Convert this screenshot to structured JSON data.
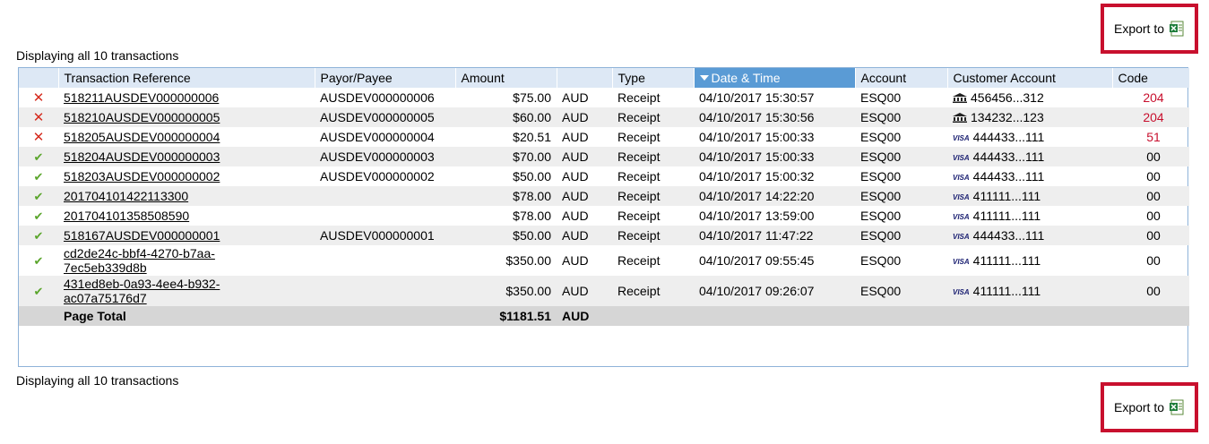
{
  "export": {
    "label": "Export to",
    "icon": "excel-icon"
  },
  "caption": {
    "top": "Displaying all 10 transactions",
    "bottom": "Displaying all 10 transactions"
  },
  "columns": {
    "ref": "Transaction Reference",
    "payor": "Payor/Payee",
    "amount": "Amount",
    "currency": "",
    "type": "Type",
    "datetime": "Date & Time",
    "account": "Account",
    "customer": "Customer Account",
    "code": "Code"
  },
  "sorted_column": "datetime",
  "rows": [
    {
      "status": "failed",
      "ref": "518211AUSDEV000000006",
      "payor": "AUSDEV000000006",
      "amount": "$75.00",
      "currency": "AUD",
      "type": "Receipt",
      "datetime": "04/10/2017 15:30:57",
      "account": "ESQ00",
      "card_type": "bank",
      "card_label": "",
      "customer": "456456...312",
      "code": "204"
    },
    {
      "status": "failed",
      "ref": "518210AUSDEV000000005",
      "payor": "AUSDEV000000005",
      "amount": "$60.00",
      "currency": "AUD",
      "type": "Receipt",
      "datetime": "04/10/2017 15:30:56",
      "account": "ESQ00",
      "card_type": "bank",
      "card_label": "",
      "customer": "134232...123",
      "code": "204"
    },
    {
      "status": "failed",
      "ref": "518205AUSDEV000000004",
      "payor": "AUSDEV000000004",
      "amount": "$20.51",
      "currency": "AUD",
      "type": "Receipt",
      "datetime": "04/10/2017 15:00:33",
      "account": "ESQ00",
      "card_type": "visa",
      "card_label": "VISA",
      "customer": "444433...111",
      "code": "51"
    },
    {
      "status": "ok",
      "ref": "518204AUSDEV000000003",
      "payor": "AUSDEV000000003",
      "amount": "$70.00",
      "currency": "AUD",
      "type": "Receipt",
      "datetime": "04/10/2017 15:00:33",
      "account": "ESQ00",
      "card_type": "visa",
      "card_label": "VISA",
      "customer": "444433...111",
      "code": "00"
    },
    {
      "status": "ok",
      "ref": "518203AUSDEV000000002",
      "payor": "AUSDEV000000002",
      "amount": "$50.00",
      "currency": "AUD",
      "type": "Receipt",
      "datetime": "04/10/2017 15:00:32",
      "account": "ESQ00",
      "card_type": "visa",
      "card_label": "VISA",
      "customer": "444433...111",
      "code": "00"
    },
    {
      "status": "ok",
      "ref": "201704101422113300",
      "payor": "",
      "amount": "$78.00",
      "currency": "AUD",
      "type": "Receipt",
      "datetime": "04/10/2017 14:22:20",
      "account": "ESQ00",
      "card_type": "visa",
      "card_label": "VISA",
      "customer": "411111...111",
      "code": "00"
    },
    {
      "status": "ok",
      "ref": "201704101358508590",
      "payor": "",
      "amount": "$78.00",
      "currency": "AUD",
      "type": "Receipt",
      "datetime": "04/10/2017 13:59:00",
      "account": "ESQ00",
      "card_type": "visa",
      "card_label": "VISA",
      "customer": "411111...111",
      "code": "00"
    },
    {
      "status": "ok",
      "ref": "518167AUSDEV000000001",
      "payor": "AUSDEV000000001",
      "amount": "$50.00",
      "currency": "AUD",
      "type": "Receipt",
      "datetime": "04/10/2017 11:47:22",
      "account": "ESQ00",
      "card_type": "visa",
      "card_label": "VISA",
      "customer": "444433...111",
      "code": "00"
    },
    {
      "status": "ok",
      "ref": "cd2de24c-bbf4-4270-b7aa-7ec5eb339d8b",
      "ref_line1": "cd2de24c-bbf4-4270-b7aa-",
      "ref_line2": "7ec5eb339d8b",
      "payor": "",
      "amount": "$350.00",
      "currency": "AUD",
      "type": "Receipt",
      "datetime": "04/10/2017 09:55:45",
      "account": "ESQ00",
      "card_type": "visa",
      "card_label": "VISA",
      "customer": "411111...111",
      "code": "00"
    },
    {
      "status": "ok",
      "ref": "431ed8eb-0a93-4ee4-b932-ac07a75176d7",
      "ref_line1": "431ed8eb-0a93-4ee4-b932-",
      "ref_line2": "ac07a75176d7",
      "payor": "",
      "amount": "$350.00",
      "currency": "AUD",
      "type": "Receipt",
      "datetime": "04/10/2017 09:26:07",
      "account": "ESQ00",
      "card_type": "visa",
      "card_label": "VISA",
      "customer": "411111...111",
      "code": "00"
    }
  ],
  "total": {
    "label": "Page Total",
    "amount": "$1181.51",
    "currency": "AUD"
  },
  "colors": {
    "error": "#c8102e",
    "ok": "#5aa52b",
    "header": "#dde8f5",
    "sorted_header": "#5a9bd5",
    "highlight_box": "#c8102e"
  }
}
